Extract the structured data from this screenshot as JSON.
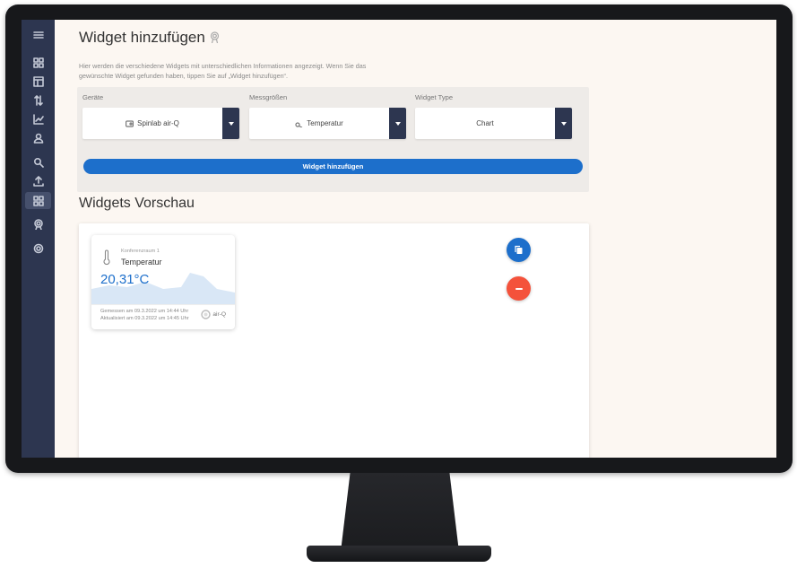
{
  "page": {
    "title": "Widget hinzufügen",
    "description": "Hier werden die verschiedene Widgets mit unterschiedlichen Informationen angezeigt. Wenn Sie das gewünschte Widget gefunden haben, tippen Sie auf „Widget hinzufügen“."
  },
  "form": {
    "device_label": "Geräte",
    "device_value": "Spinlab air-Q",
    "measure_label": "Messgrößen",
    "measure_value": "Temperatur",
    "type_label": "Widget Type",
    "type_value": "Chart",
    "add_label": "Widget hinzufügen"
  },
  "preview": {
    "title": "Widgets Vorschau",
    "widget": {
      "subtitle": "Konferenzraum 1",
      "title": "Temperatur",
      "value": "20,31°C",
      "measured": "Gemessen am 09.3.2022 um 14:44 Uhr",
      "updated": "Aktualisiert am 09.3.2022 um 14:45 Uhr",
      "brand": "air-Q"
    }
  },
  "sidebar": {
    "items": [
      "menu-icon",
      "dashboard-icon",
      "table-icon",
      "sort-icon",
      "chart-icon",
      "user-icon",
      "search-icon",
      "upload-icon",
      "widgets-icon",
      "badge-icon",
      "settings-icon"
    ],
    "active_index": 8
  },
  "colors": {
    "sidebar": "#2d3650",
    "accent": "#1d6fcb",
    "danger": "#f4523b",
    "background": "#fcf7f2"
  }
}
